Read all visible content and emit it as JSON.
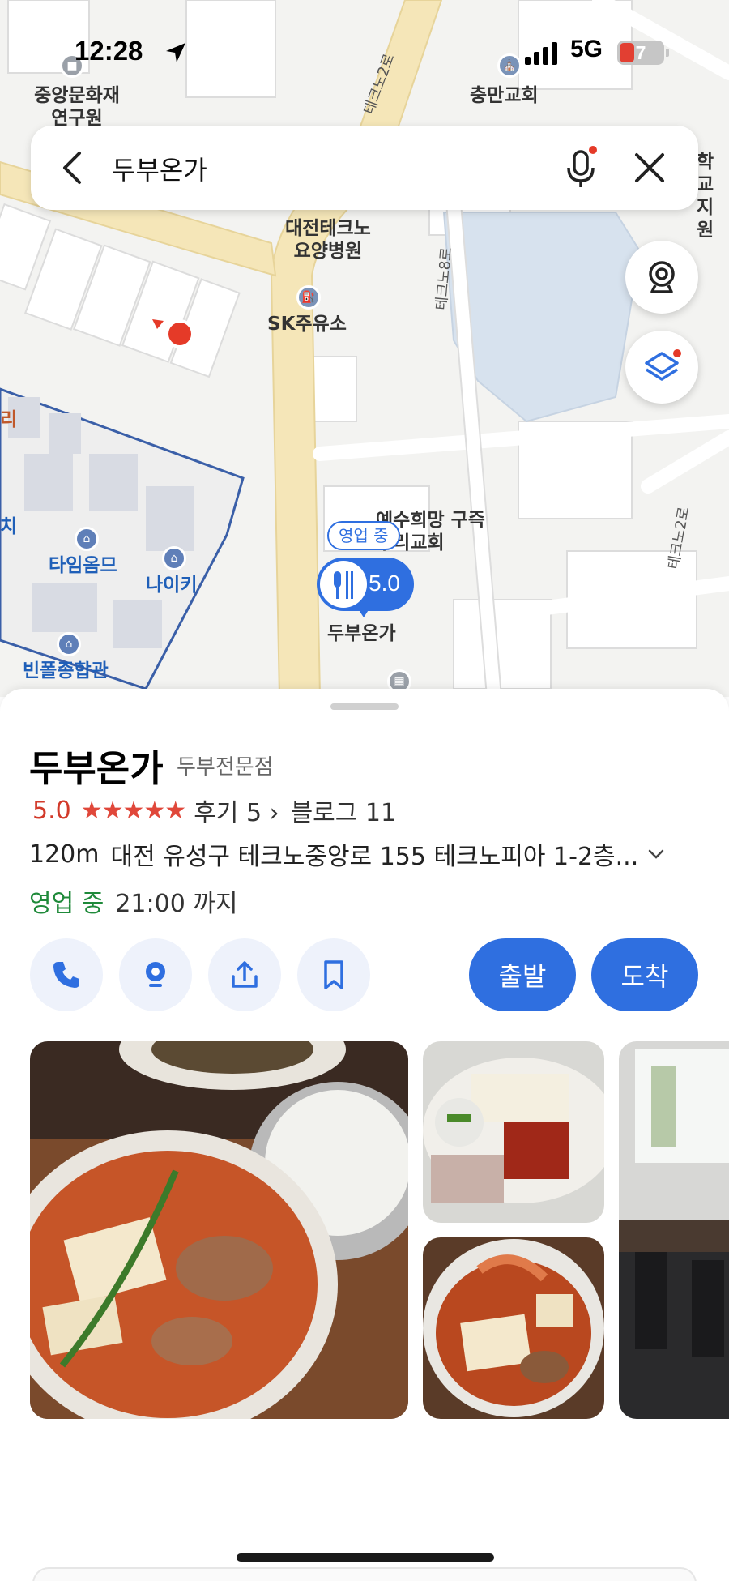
{
  "status_bar": {
    "time": "12:28",
    "network": "5G",
    "battery": "7"
  },
  "search": {
    "query": "두부온가"
  },
  "map": {
    "labels": {
      "joongang": "중앙문화재\n연구원",
      "chungman": "충만교회",
      "daejeon_hospital": "대전테크노\n요양병원",
      "sk": "SK주유소",
      "church": "예수희망 구즉\n우리교회",
      "timeomm": "타임옴므",
      "nike": "나이키",
      "binpol": "빈폴종합관",
      "school": "학교\n지원",
      "place": "두부온가",
      "ri": "리",
      "chi": "치"
    },
    "road_labels": {
      "road1": "테크노2로",
      "road2": "테크노8로",
      "road3": "테크노2로"
    },
    "marker_rating": "5.0",
    "open_badge": "영업 중"
  },
  "place": {
    "name": "두부온가",
    "category": "두부전문점",
    "rating": "5.0",
    "stars": "★★★★★",
    "reviews": "후기 5",
    "blog": "블로그 11",
    "distance": "120m",
    "address": "대전 유성구 테크노중앙로 155 테크노피아 1-2층...",
    "open_status": "영업 중",
    "hours": "21:00 까지"
  },
  "actions": {
    "depart": "출발",
    "arrive": "도착"
  },
  "icons": [
    "back-arrow-icon",
    "mic-icon",
    "close-icon",
    "cctv-icon",
    "layers-icon",
    "phone-icon",
    "street-view-icon",
    "share-icon",
    "bookmark-icon",
    "restaurant-icon"
  ],
  "colors": {
    "accent": "#2f6fe0",
    "rating": "#d23a2a",
    "open": "#1f8a3a"
  }
}
